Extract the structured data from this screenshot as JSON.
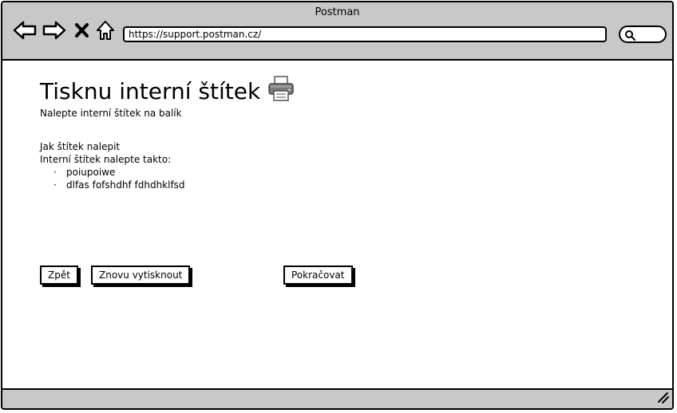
{
  "window": {
    "title": "Postman"
  },
  "browser": {
    "url": "https://support.postman.cz/"
  },
  "page": {
    "heading": "Tisknu interní štítek",
    "subtitle": "Nalepte interní štítek na balík",
    "howto_title": "Jak štítek nalepit",
    "howto_intro": "Interní štítek nalepte takto:",
    "steps": [
      "poiupoiwe",
      "dlfas fofshdhf fdhdhklfsd"
    ]
  },
  "buttons": {
    "back": "Zpět",
    "reprint": "Znovu vytisknout",
    "continue": "Pokračovat"
  },
  "icons": {
    "heading": "printer-icon"
  }
}
